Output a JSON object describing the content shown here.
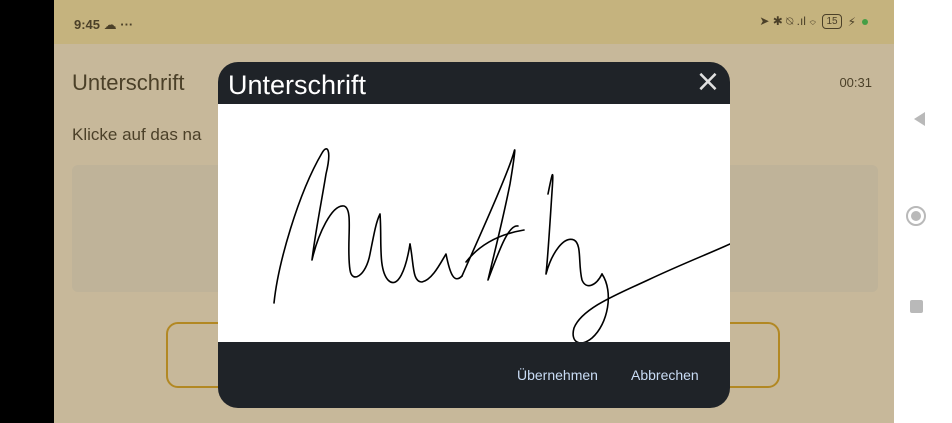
{
  "status_bar": {
    "time": "9:45",
    "left_icons": "☁ ···",
    "right_icons": "➤ ✱ ⍉ .ıl ⌔",
    "battery": "15",
    "charge_icon": "⚡"
  },
  "page": {
    "title": "Unterschrift",
    "timer": "00:31",
    "instruction": "Klicke auf das na"
  },
  "dialog": {
    "title": "Unterschrift",
    "close_icon": "×",
    "accept_label": "Übernehmen",
    "cancel_label": "Abbrechen"
  },
  "icons": {
    "nav_back": "back-triangle-icon",
    "nav_home": "home-circle-icon",
    "nav_recent": "recent-square-icon"
  },
  "colors": {
    "page_bg": "#f7ecd3",
    "status_bg": "#f5e3a8",
    "dialog_bg": "#1f2328",
    "accent_outline": "#d8a21c",
    "action_text": "#c9dcf5"
  }
}
